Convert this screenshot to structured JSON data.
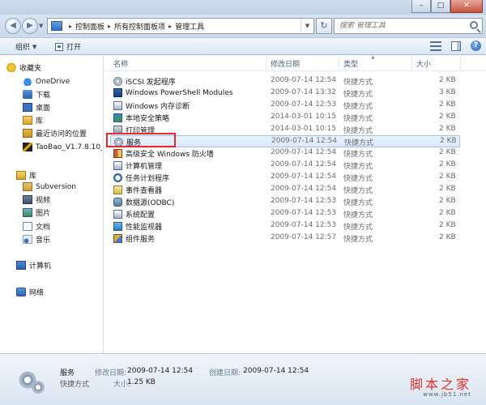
{
  "window": {
    "controls": {
      "minimize": "–",
      "maximize": "□",
      "close": "✕"
    }
  },
  "nav": {
    "back_glyph": "◀",
    "forward_glyph": "▶",
    "breadcrumb": [
      "控制面板",
      "所有控制面板项",
      "管理工具"
    ],
    "refresh_glyph": "↻",
    "search_placeholder": "搜索 管理工具"
  },
  "toolbar": {
    "organize_label": "组织",
    "open_label": "打开"
  },
  "sidebar": {
    "favorites": {
      "label": "收藏夹",
      "items": [
        "OneDrive",
        "下载",
        "桌面",
        "库",
        "最近访问的位置",
        "TaoBao_V1.7.8.10_"
      ]
    },
    "libraries": {
      "label": "库",
      "items": [
        "Subversion",
        "视频",
        "图片",
        "文档",
        "音乐"
      ]
    },
    "computer": {
      "label": "计算机"
    },
    "network": {
      "label": "网络"
    }
  },
  "columns": {
    "name": "名称",
    "date": "修改日期",
    "type": "类型",
    "size": "大小"
  },
  "files": [
    {
      "name": "iSCSI 发起程序",
      "date": "2009-07-14 12:54",
      "type": "快捷方式",
      "size": "2 KB",
      "icon": "gear-icon"
    },
    {
      "name": "Windows PowerShell Modules",
      "date": "2009-07-14 13:32",
      "type": "快捷方式",
      "size": "3 KB",
      "icon": "powershell-icon"
    },
    {
      "name": "Windows 内存诊断",
      "date": "2009-07-14 12:53",
      "type": "快捷方式",
      "size": "2 KB",
      "icon": "memory-diagnostic-icon"
    },
    {
      "name": "本地安全策略",
      "date": "2014-03-01 10:15",
      "type": "快捷方式",
      "size": "2 KB",
      "icon": "security-policy-icon"
    },
    {
      "name": "打印管理",
      "date": "2014-03-01 10:15",
      "type": "快捷方式",
      "size": "2 KB",
      "icon": "printer-icon"
    },
    {
      "name": "服务",
      "date": "2009-07-14 12:54",
      "type": "快捷方式",
      "size": "2 KB",
      "icon": "services-gear-icon"
    },
    {
      "name": "高级安全 Windows 防火墙",
      "date": "2009-07-14 12:54",
      "type": "快捷方式",
      "size": "2 KB",
      "icon": "firewall-icon"
    },
    {
      "name": "计算机管理",
      "date": "2009-07-14 12:54",
      "type": "快捷方式",
      "size": "2 KB",
      "icon": "computer-management-icon"
    },
    {
      "name": "任务计划程序",
      "date": "2009-07-14 12:54",
      "type": "快捷方式",
      "size": "2 KB",
      "icon": "task-scheduler-icon"
    },
    {
      "name": "事件查看器",
      "date": "2009-07-14 12:54",
      "type": "快捷方式",
      "size": "2 KB",
      "icon": "event-viewer-icon"
    },
    {
      "name": "数据源(ODBC)",
      "date": "2009-07-14 12:53",
      "type": "快捷方式",
      "size": "2 KB",
      "icon": "database-icon"
    },
    {
      "name": "系统配置",
      "date": "2009-07-14 12:53",
      "type": "快捷方式",
      "size": "2 KB",
      "icon": "system-config-icon"
    },
    {
      "name": "性能监视器",
      "date": "2009-07-14 12:53",
      "type": "快捷方式",
      "size": "2 KB",
      "icon": "performance-monitor-icon"
    },
    {
      "name": "组件服务",
      "date": "2009-07-14 12:57",
      "type": "快捷方式",
      "size": "2 KB",
      "icon": "component-services-icon"
    }
  ],
  "selected_index": 5,
  "details": {
    "name": "服务",
    "type": "快捷方式",
    "modified_label": "修改日期:",
    "modified_value": "2009-07-14 12:54",
    "created_label": "创建日期:",
    "created_value": "2009-07-14 12:54",
    "size_label": "大小:",
    "size_value": "1.25 KB"
  },
  "watermark": {
    "text": "脚本之家",
    "url": "www.jb51.net"
  },
  "colors": {
    "selection_border": "#9ec2ea",
    "highlight_box": "#e8262d",
    "watermark": "#e0322a"
  }
}
